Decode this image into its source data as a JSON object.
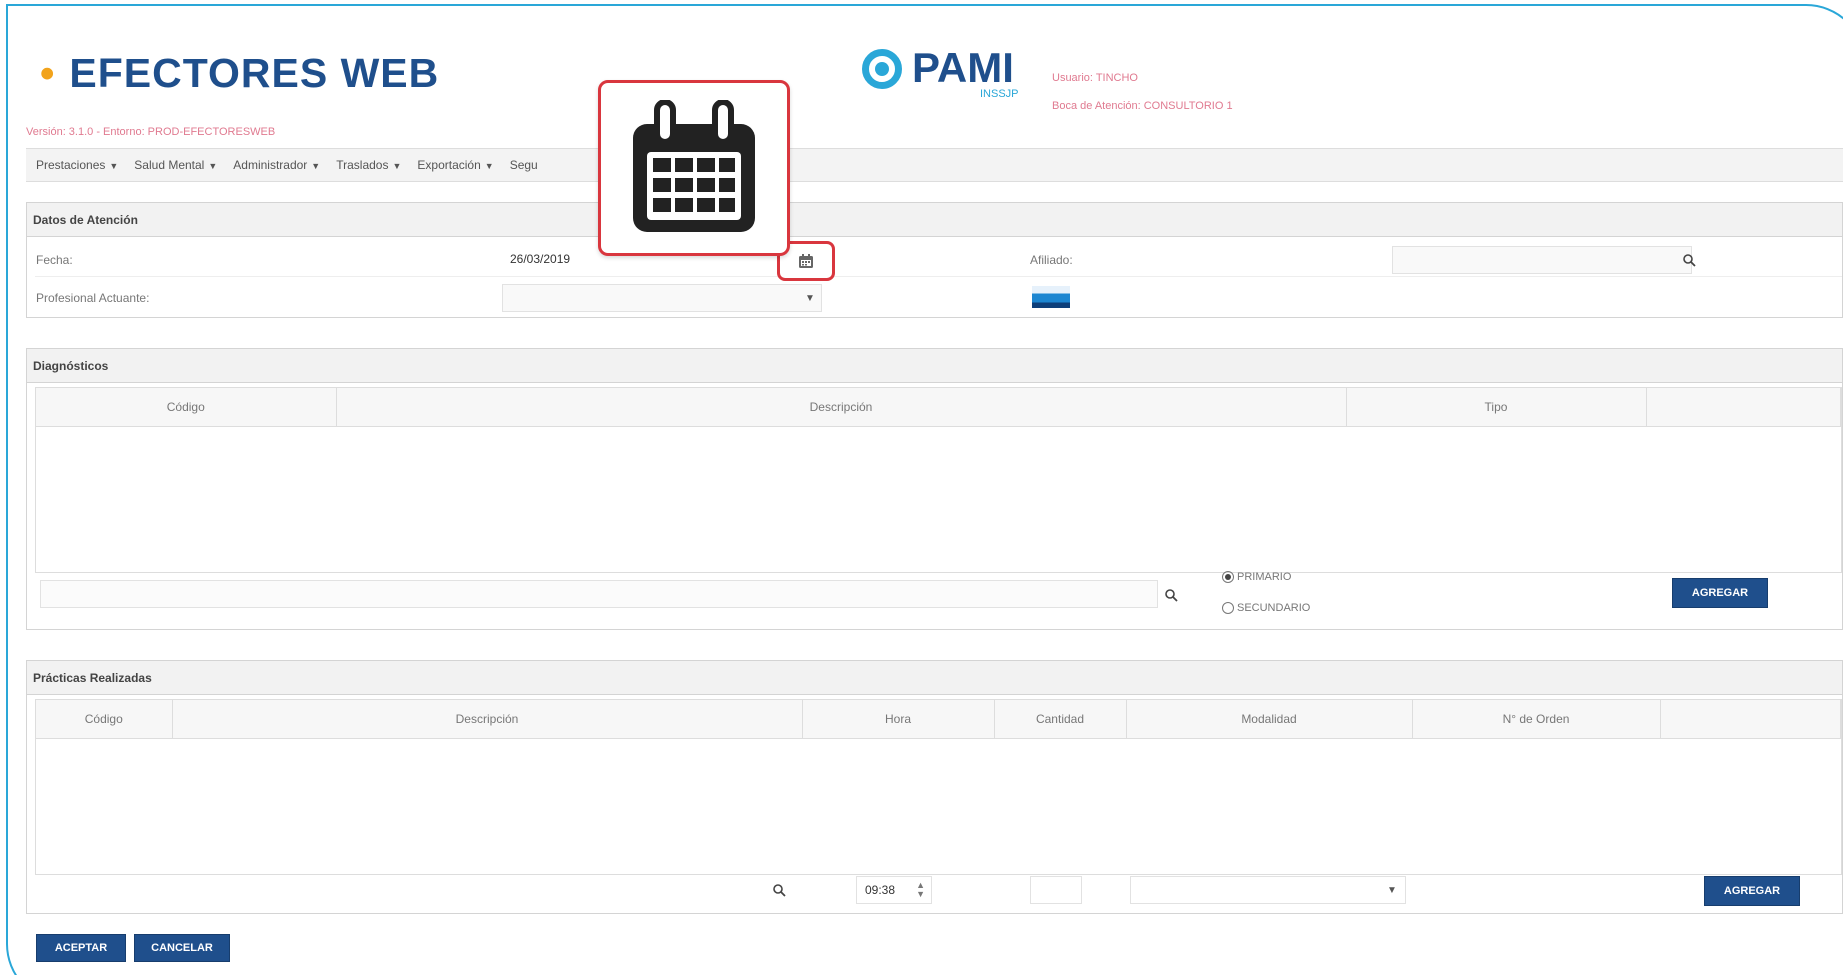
{
  "header": {
    "title": "EFECTORES WEB",
    "logo_text": "PAMI",
    "logo_sub": "INSSJP",
    "user_line": "Usuario: TINCHO",
    "box_line": "Boca de Atención: CONSULTORIO 1",
    "version": "Versión: 3.1.0 - Entorno: PROD-EFECTORESWEB"
  },
  "nav": {
    "items": [
      "Prestaciones",
      "Salud Mental",
      "Administrador",
      "Traslados",
      "Exportación",
      "Segu"
    ]
  },
  "atencion": {
    "title": "Datos de Atención",
    "fecha_label": "Fecha:",
    "fecha_value": "26/03/2019",
    "afiliado_label": "Afiliado:",
    "profesional_label": "Profesional Actuante:"
  },
  "diagnosticos": {
    "title": "Diagnósticos",
    "columns": [
      "Código",
      "Descripción",
      "Tipo",
      ""
    ],
    "radio_primary": "PRIMARIO",
    "radio_secondary": "SECUNDARIO",
    "add_label": "AGREGAR"
  },
  "practicas": {
    "title": "Prácticas Realizadas",
    "columns": [
      "Código",
      "Descripción",
      "Hora",
      "Cantidad",
      "Modalidad",
      "N° de Orden",
      ""
    ],
    "hora_value": "09:38",
    "add_label": "AGREGAR"
  },
  "footer": {
    "accept_label": "ACEPTAR",
    "cancel_label": "CANCELAR"
  },
  "colors": {
    "brand_blue": "#1f4f8c",
    "accent_cyan": "#2aa7d8",
    "highlight_red": "#d9363e"
  }
}
